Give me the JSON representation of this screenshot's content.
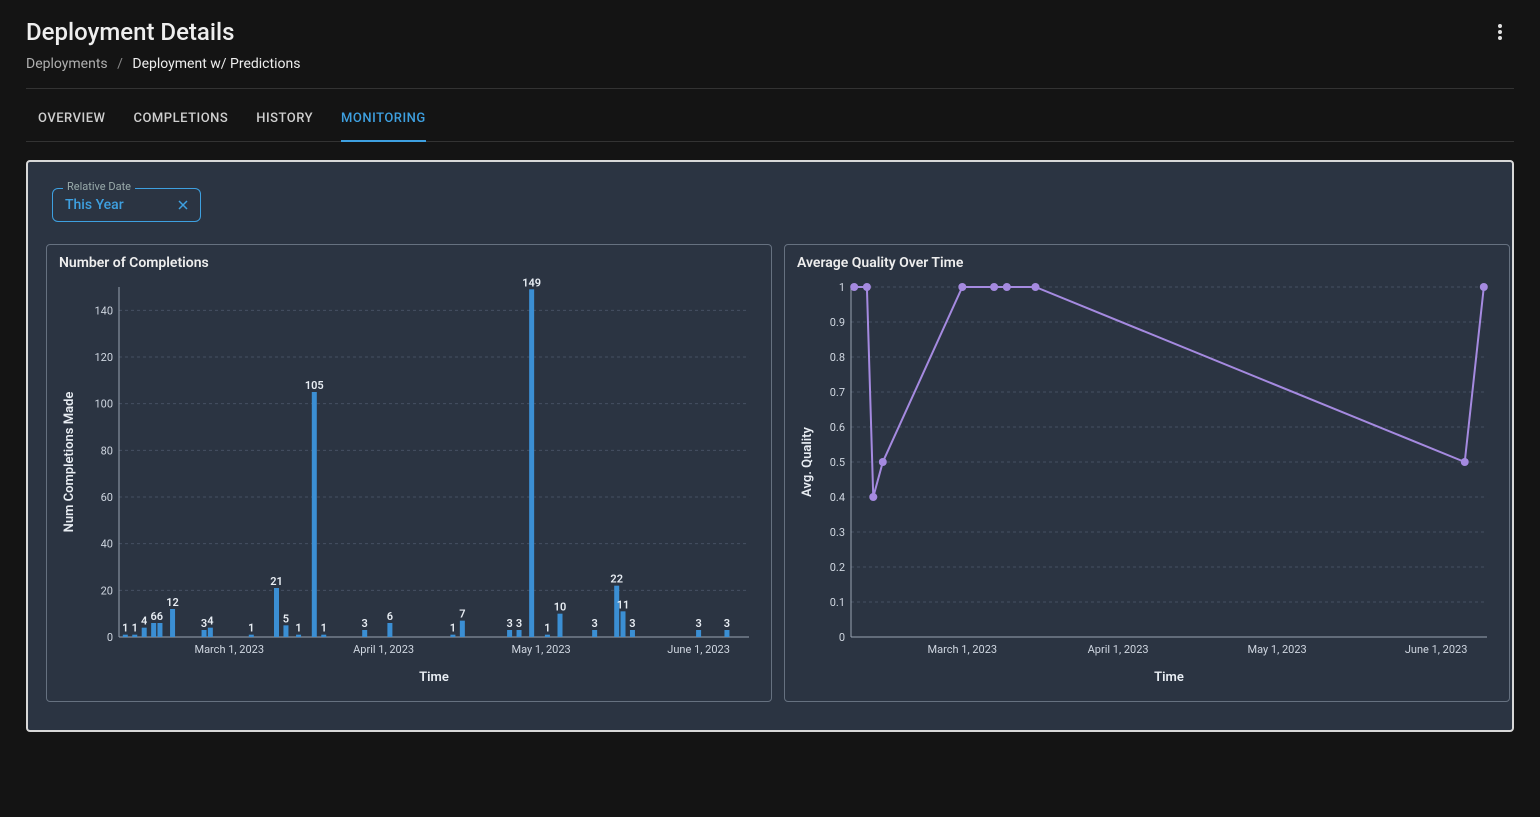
{
  "header": {
    "title": "Deployment Details"
  },
  "breadcrumb": {
    "root": "Deployments",
    "current": "Deployment w/ Predictions",
    "separator": "/"
  },
  "tabs": [
    {
      "id": "overview",
      "label": "OVERVIEW",
      "active": false
    },
    {
      "id": "completions",
      "label": "COMPLETIONS",
      "active": false
    },
    {
      "id": "history",
      "label": "HISTORY",
      "active": false
    },
    {
      "id": "monitoring",
      "label": "MONITORING",
      "active": true
    }
  ],
  "filter": {
    "legend": "Relative Date",
    "value": "This Year"
  },
  "chart_data": [
    {
      "type": "bar",
      "title": "Number of Completions",
      "xlabel": "Time",
      "ylabel": "Num Completions Made",
      "ylim": [
        0,
        150
      ],
      "yticks": [
        0,
        20,
        40,
        60,
        80,
        100,
        120,
        140
      ],
      "xticks": [
        "March 1, 2023",
        "April 1, 2023",
        "May 1, 2023",
        "June 1, 2023"
      ],
      "xtick_positions": [
        0.175,
        0.42,
        0.67,
        0.92
      ],
      "bars": [
        {
          "pos": 0.01,
          "value": 1,
          "label": "1"
        },
        {
          "pos": 0.025,
          "value": 1,
          "label": "1"
        },
        {
          "pos": 0.04,
          "value": 4,
          "label": "4"
        },
        {
          "pos": 0.055,
          "value": 6,
          "label": "6"
        },
        {
          "pos": 0.065,
          "value": 6,
          "label": "6"
        },
        {
          "pos": 0.085,
          "value": 12,
          "label": "12"
        },
        {
          "pos": 0.135,
          "value": 3,
          "label": "3"
        },
        {
          "pos": 0.145,
          "value": 4,
          "label": "4"
        },
        {
          "pos": 0.21,
          "value": 1,
          "label": "1"
        },
        {
          "pos": 0.25,
          "value": 21,
          "label": "21"
        },
        {
          "pos": 0.265,
          "value": 5,
          "label": "5"
        },
        {
          "pos": 0.285,
          "value": 1,
          "label": "1"
        },
        {
          "pos": 0.31,
          "value": 105,
          "label": "105"
        },
        {
          "pos": 0.325,
          "value": 1,
          "label": "1"
        },
        {
          "pos": 0.39,
          "value": 3,
          "label": "3"
        },
        {
          "pos": 0.43,
          "value": 6,
          "label": "6"
        },
        {
          "pos": 0.53,
          "value": 1,
          "label": "1"
        },
        {
          "pos": 0.545,
          "value": 7,
          "label": "7"
        },
        {
          "pos": 0.62,
          "value": 3,
          "label": "3"
        },
        {
          "pos": 0.635,
          "value": 3,
          "label": "3"
        },
        {
          "pos": 0.655,
          "value": 149,
          "label": "149"
        },
        {
          "pos": 0.68,
          "value": 1,
          "label": "1"
        },
        {
          "pos": 0.7,
          "value": 10,
          "label": "10"
        },
        {
          "pos": 0.755,
          "value": 3,
          "label": "3"
        },
        {
          "pos": 0.79,
          "value": 22,
          "label": "22"
        },
        {
          "pos": 0.8,
          "value": 11,
          "label": "11"
        },
        {
          "pos": 0.815,
          "value": 3,
          "label": "3"
        },
        {
          "pos": 0.92,
          "value": 3,
          "label": "3"
        },
        {
          "pos": 0.965,
          "value": 3,
          "label": "3"
        }
      ]
    },
    {
      "type": "line",
      "title": "Average Quality Over Time",
      "xlabel": "Time",
      "ylabel": "Avg. Quality",
      "ylim": [
        0,
        1
      ],
      "yticks": [
        0,
        0.1,
        0.2,
        0.3,
        0.4,
        0.5,
        0.6,
        0.7,
        0.8,
        0.9,
        1
      ],
      "xticks": [
        "March 1, 2023",
        "April 1, 2023",
        "May 1, 2023",
        "June 1, 2023"
      ],
      "xtick_positions": [
        0.175,
        0.42,
        0.67,
        0.92
      ],
      "points": [
        {
          "pos": 0.005,
          "value": 1
        },
        {
          "pos": 0.025,
          "value": 1
        },
        {
          "pos": 0.035,
          "value": 0.4
        },
        {
          "pos": 0.05,
          "value": 0.5
        },
        {
          "pos": 0.175,
          "value": 1
        },
        {
          "pos": 0.225,
          "value": 1
        },
        {
          "pos": 0.245,
          "value": 1
        },
        {
          "pos": 0.29,
          "value": 1
        },
        {
          "pos": 0.965,
          "value": 0.5
        },
        {
          "pos": 0.995,
          "value": 1
        }
      ]
    }
  ]
}
